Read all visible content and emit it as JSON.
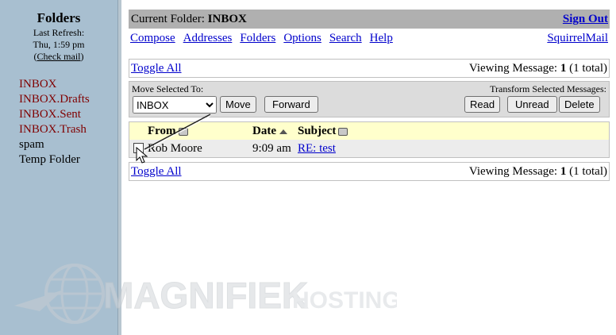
{
  "sidebar": {
    "title": "Folders",
    "last_refresh_label": "Last Refresh:",
    "last_refresh_time": "Thu, 1:59 pm",
    "check_mail_prefix": "(",
    "check_mail": "Check mail",
    "check_mail_suffix": ")",
    "folders": [
      {
        "label": "INBOX",
        "color": "#800000"
      },
      {
        "label": "INBOX.Drafts",
        "color": "#800000"
      },
      {
        "label": "INBOX.Sent",
        "color": "#800000"
      },
      {
        "label": "INBOX.Trash",
        "color": "#800000"
      },
      {
        "label": "spam",
        "color": "#000000"
      },
      {
        "label": "Temp Folder",
        "color": "#000000"
      }
    ]
  },
  "header": {
    "current_folder_label": "Current Folder:",
    "current_folder": "INBOX",
    "sign_out": "Sign Out"
  },
  "nav": {
    "links": [
      "Compose",
      "Addresses",
      "Folders",
      "Options",
      "Search",
      "Help"
    ],
    "brand": "SquirrelMail"
  },
  "viewbar": {
    "toggle_all": "Toggle All",
    "viewing_prefix": "Viewing Message:",
    "viewing_num": "1",
    "viewing_suffix": "(1 total)"
  },
  "actions": {
    "move_label": "Move Selected To:",
    "move_target": "INBOX",
    "move_button": "Move",
    "forward_button": "Forward",
    "transform_label": "Transform Selected Messages:",
    "read_button": "Read",
    "unread_button": "Unread",
    "delete_button": "Delete"
  },
  "list": {
    "headers": {
      "from": "From",
      "date": "Date",
      "subject": "Subject"
    },
    "rows": [
      {
        "from": "Rob Moore",
        "date": "9:09 am",
        "subject": "RE: test"
      }
    ]
  },
  "watermark": {
    "brand": "MAGNIFIEK",
    "suffix": "HOSTING"
  },
  "colors": {
    "link": "#0000cc",
    "folder_red": "#800000",
    "sidebar_bg": "#a8bfd0",
    "header_row": "#ffffcc"
  }
}
